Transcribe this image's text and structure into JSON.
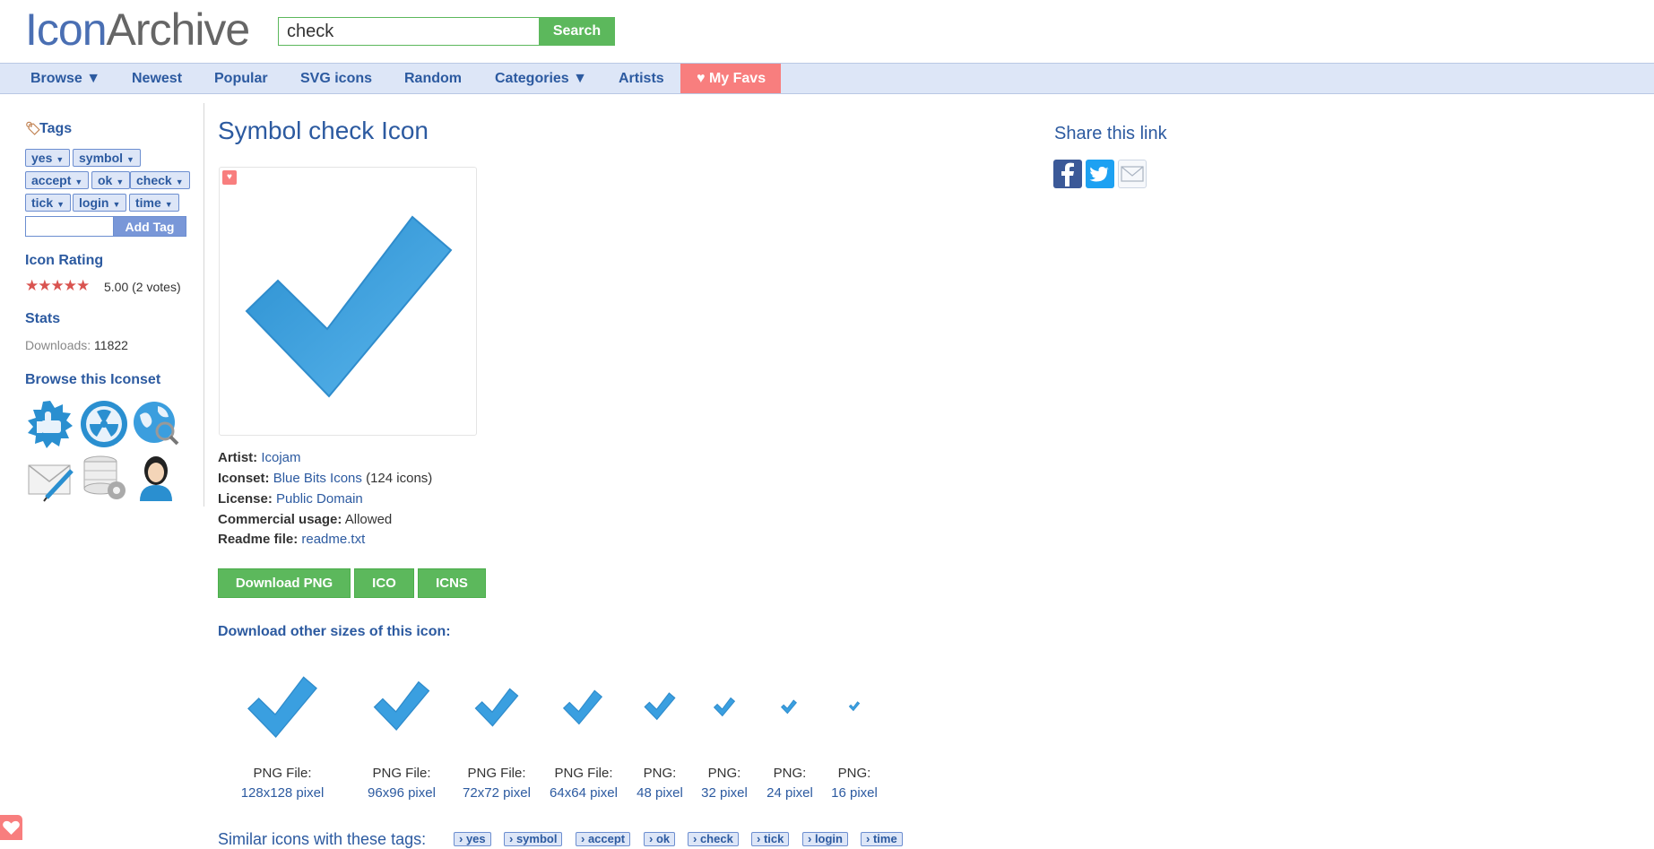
{
  "header": {
    "logo_part1": "Icon",
    "logo_part2": "Archive",
    "search_value": "check",
    "search_button": "Search"
  },
  "nav": {
    "items": [
      "Browse ▼",
      "Newest",
      "Popular",
      "SVG icons",
      "Random",
      "Categories ▼",
      "Artists",
      "♥ My Favs"
    ]
  },
  "sidebar": {
    "tags_heading": "Tags",
    "tags": [
      "yes",
      "symbol",
      "accept",
      "ok",
      "check",
      "tick",
      "login",
      "time"
    ],
    "add_tag_button": "Add Tag",
    "rating_heading": "Icon Rating",
    "stars": "★★★★★",
    "rating_text": "5.00 (2 votes)",
    "rating_value": 5.0,
    "stats_heading": "Stats",
    "downloads_label": "Downloads:",
    "downloads_value": "11822",
    "browse_heading": "Browse this Iconset",
    "iconset_icons": [
      "thumbs-up-icon",
      "radiation-icon",
      "globe-search-icon",
      "mail-pen-icon",
      "database-gear-icon",
      "user-female-icon"
    ]
  },
  "main": {
    "title": "Symbol check Icon",
    "artist_label": "Artist:",
    "artist": "Icojam",
    "iconset_label": "Iconset:",
    "iconset": "Blue Bits Icons",
    "iconset_count": "(124 icons)",
    "license_label": "License:",
    "license": "Public Domain",
    "commercial_label": "Commercial usage:",
    "commercial": "Allowed",
    "readme_label": "Readme file:",
    "readme": "readme.txt",
    "download_png": "Download PNG",
    "download_ico": "ICO",
    "download_icns": "ICNS",
    "sizes_heading": "Download other sizes of this icon:",
    "sizes": [
      {
        "label": "PNG File:",
        "link": "128x128 pixel"
      },
      {
        "label": "PNG File:",
        "link": "96x96 pixel"
      },
      {
        "label": "PNG File:",
        "link": "72x72 pixel"
      },
      {
        "label": "PNG File:",
        "link": "64x64 pixel"
      },
      {
        "label": "PNG:",
        "link": "48 pixel"
      },
      {
        "label": "PNG:",
        "link": "32 pixel"
      },
      {
        "label": "PNG:",
        "link": "24 pixel"
      },
      {
        "label": "PNG:",
        "link": "16 pixel"
      }
    ],
    "similar_text": "Similar icons with these tags:",
    "similar_tags": [
      "› yes",
      "› symbol",
      "› accept",
      "› ok",
      "› check",
      "› tick",
      "› login",
      "› time"
    ]
  },
  "share": {
    "heading": "Share this link",
    "buttons": [
      "facebook-icon",
      "twitter-icon",
      "email-icon"
    ]
  },
  "colors": {
    "brand_blue": "#2c5aa0",
    "nav_bg": "#dde6f7",
    "green": "#5cb85c",
    "fav_red": "#f87e7e"
  }
}
